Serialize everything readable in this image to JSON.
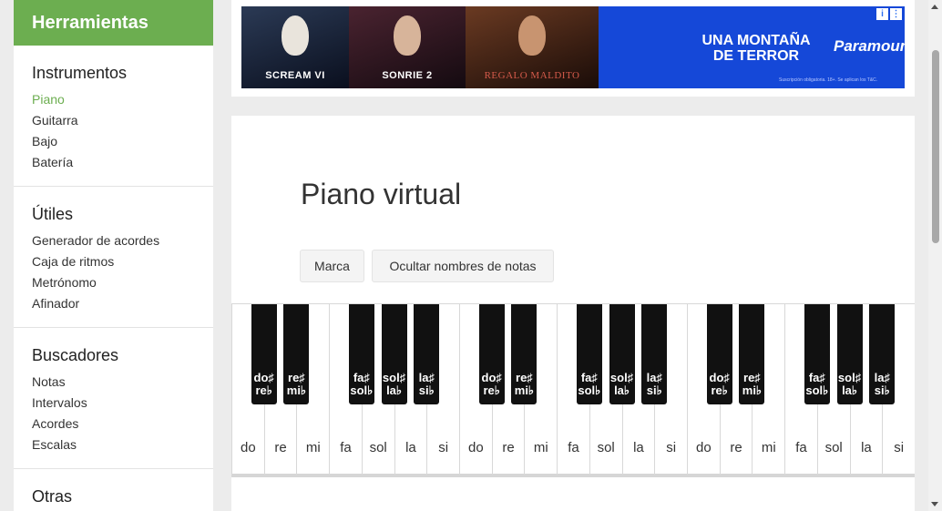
{
  "sidebar": {
    "title": "Herramientas",
    "sections": [
      {
        "heading": "Instrumentos",
        "items": [
          {
            "label": "Piano",
            "active": true
          },
          {
            "label": "Guitarra"
          },
          {
            "label": "Bajo"
          },
          {
            "label": "Batería"
          }
        ]
      },
      {
        "heading": "Útiles",
        "items": [
          {
            "label": "Generador de acordes"
          },
          {
            "label": "Caja de ritmos"
          },
          {
            "label": "Metrónomo"
          },
          {
            "label": "Afinador"
          }
        ]
      },
      {
        "heading": "Buscadores",
        "items": [
          {
            "label": "Notas"
          },
          {
            "label": "Intervalos"
          },
          {
            "label": "Acordes"
          },
          {
            "label": "Escalas"
          }
        ]
      },
      {
        "heading": "Otras",
        "items": []
      }
    ]
  },
  "ad": {
    "panels": [
      "SCREAM VI",
      "SONRIE 2",
      "REGALO MALDITO"
    ],
    "headline_line1": "UNA MONTAÑA",
    "headline_line2": "DE TERROR",
    "brand": "Paramount+",
    "fineprint": "Suscripción obligatoria. 18+. Se aplican los T&C."
  },
  "main": {
    "title": "Piano virtual",
    "buttons": {
      "marca": "Marca",
      "hide_notes": "Ocultar nombres de notas"
    }
  },
  "piano": {
    "white_keys": [
      "do",
      "re",
      "mi",
      "fa",
      "sol",
      "la",
      "si",
      "do",
      "re",
      "mi",
      "fa",
      "sol",
      "la",
      "si",
      "do",
      "re",
      "mi",
      "fa",
      "sol",
      "la",
      "si"
    ],
    "black_keys": [
      {
        "sharp": "do♯",
        "flat": "re♭"
      },
      {
        "sharp": "re♯",
        "flat": "mi♭"
      },
      {
        "sharp": "fa♯",
        "flat": "sol♭"
      },
      {
        "sharp": "sol♯",
        "flat": "la♭"
      },
      {
        "sharp": "la♯",
        "flat": "si♭"
      },
      {
        "sharp": "do♯",
        "flat": "re♭"
      },
      {
        "sharp": "re♯",
        "flat": "mi♭"
      },
      {
        "sharp": "fa♯",
        "flat": "sol♭"
      },
      {
        "sharp": "sol♯",
        "flat": "la♭"
      },
      {
        "sharp": "la♯",
        "flat": "si♭"
      },
      {
        "sharp": "do♯",
        "flat": "re♭"
      },
      {
        "sharp": "re♯",
        "flat": "mi♭"
      },
      {
        "sharp": "fa♯",
        "flat": "sol♭"
      },
      {
        "sharp": "sol♯",
        "flat": "la♭"
      },
      {
        "sharp": "la♯",
        "flat": "si♭"
      }
    ]
  },
  "colors": {
    "accent": "#6cae50",
    "ad_blue": "#1548d8"
  }
}
